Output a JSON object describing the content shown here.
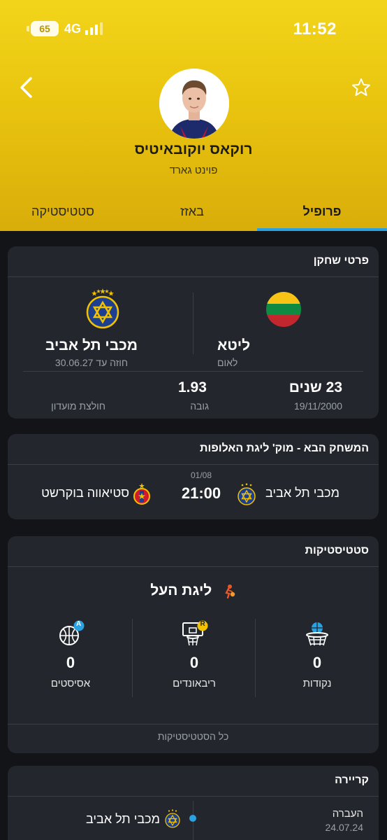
{
  "status_bar": {
    "time": "11:52",
    "battery": "65",
    "network": "4G"
  },
  "player": {
    "name": "רוקאס יוקובאיטיס",
    "position": "פוינט גארד"
  },
  "tabs": [
    {
      "label": "פרופיל",
      "active": true
    },
    {
      "label": "באזז",
      "active": false
    },
    {
      "label": "סטטיסטיקה",
      "active": false
    }
  ],
  "player_details": {
    "title": "פרטי שחקן",
    "nationality": {
      "value": "ליטא",
      "label": "לאום"
    },
    "club": {
      "value": "מכבי תל אביב",
      "label": "חוזה עד 30.06.27"
    },
    "age": {
      "value": "23 שנים",
      "label": "19/11/2000"
    },
    "height": {
      "value": "1.93",
      "label": "גובה"
    },
    "jersey": {
      "label": "חולצת מועדון"
    }
  },
  "next_game": {
    "title": "המשחק הבא - מוק' ליגת האלופות",
    "date": "01/08",
    "time": "21:00",
    "home_team": "מכבי תל אביב",
    "away_team": "סטיאווה בוקרשט"
  },
  "statistics": {
    "title": "סטטיסטיקות",
    "league": "ליגת העל",
    "items": [
      {
        "label": "נקודות",
        "value": "0",
        "icon": "basketball-hoop-icon"
      },
      {
        "label": "ריבאונדים",
        "value": "0",
        "icon": "rebound-icon",
        "badge": "R"
      },
      {
        "label": "אסיסטים",
        "value": "0",
        "icon": "assist-icon",
        "badge": "A"
      }
    ],
    "all_link": "כל הסטטיסטיקות"
  },
  "career": {
    "title": "קריירה",
    "transfer_label": "העברה",
    "transfer_date": "24.07.24",
    "club": "מכבי תל אביב"
  },
  "colors": {
    "header_yellow": "#f2d51a",
    "accent_blue": "#2aa1e0",
    "card_bg": "#23272d",
    "page_bg": "#121418"
  }
}
